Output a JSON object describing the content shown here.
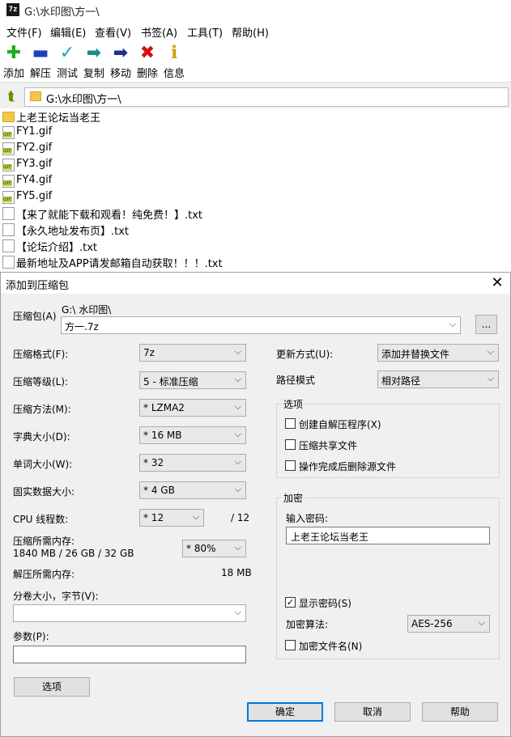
{
  "window": {
    "title": "G:\\水印图\\方一\\",
    "app_icon": "7z"
  },
  "menu": [
    "文件(F)",
    "编辑(E)",
    "查看(V)",
    "书签(A)",
    "工具(T)",
    "帮助(H)"
  ],
  "toolbar": [
    {
      "label": "添加",
      "icon": "plus-icon",
      "glyph": "✚",
      "color": "#22aa22"
    },
    {
      "label": "解压",
      "icon": "minus-icon",
      "glyph": "▬",
      "color": "#1f3fbf"
    },
    {
      "label": "测试",
      "icon": "check-icon",
      "glyph": "✓",
      "color": "#19a7b5"
    },
    {
      "label": "复制",
      "icon": "copy-arrow-icon",
      "glyph": "➡",
      "color": "#1a8a8a"
    },
    {
      "label": "移动",
      "icon": "move-arrow-icon",
      "glyph": "➡",
      "color": "#1c2f8f"
    },
    {
      "label": "删除",
      "icon": "delete-icon",
      "glyph": "✖",
      "color": "#d01010"
    },
    {
      "label": "信息",
      "icon": "info-icon",
      "glyph": "ℹ",
      "color": "#c9a400"
    }
  ],
  "address": {
    "path": "G:\\水印图\\方一\\"
  },
  "files": [
    {
      "name": "上老王论坛当老王",
      "type": "folder"
    },
    {
      "name": "FY1.gif",
      "type": "gif"
    },
    {
      "name": "FY2.gif",
      "type": "gif"
    },
    {
      "name": "FY3.gif",
      "type": "gif"
    },
    {
      "name": "FY4.gif",
      "type": "gif"
    },
    {
      "name": "FY5.gif",
      "type": "gif"
    },
    {
      "name": "【来了就能下载和观看！纯免费！】.txt",
      "type": "txt"
    },
    {
      "name": "【永久地址发布页】.txt",
      "type": "txt"
    },
    {
      "name": "【论坛介绍】.txt",
      "type": "txt"
    },
    {
      "name": "最新地址及APP请发邮箱自动获取！！！.txt",
      "type": "txt"
    }
  ],
  "dialog": {
    "title": "添加到压缩包",
    "archive_label": "压缩包(A)",
    "archive_dir": "G:\\ 水印图\\",
    "archive_name": "方一.7z",
    "browse_label": "...",
    "format_label": "压缩格式(F):",
    "format_value": "7z",
    "level_label": "压缩等级(L):",
    "level_value": "5 - 标准压缩",
    "method_label": "压缩方法(M):",
    "method_value": "*  LZMA2",
    "dict_label": "字典大小(D):",
    "dict_value": "*  16 MB",
    "word_label": "单词大小(W):",
    "word_value": "*  32",
    "solid_label": "固实数据大小:",
    "solid_value": "*  4 GB",
    "cpu_label": "CPU 线程数:",
    "cpu_value": "*  12",
    "cpu_total": "/  12",
    "mem_label": "压缩所需内存:",
    "mem_detail": "1840 MB / 26 GB / 32 GB",
    "mem_value": "*  80%",
    "decomp_label": "解压所需内存:",
    "decomp_value": "18 MB",
    "split_label": "分卷大小，字节(V):",
    "split_value": "",
    "params_label": "参数(P):",
    "params_value": "",
    "options_button": "选项",
    "update_label": "更新方式(U):",
    "update_value": "添加并替换文件",
    "path_label": "路径模式",
    "path_value": "相对路径",
    "options_group": "选项",
    "opt_sfx": "创建自解压程序(X)",
    "opt_shared": "压缩共享文件",
    "opt_delete": "操作完成后删除源文件",
    "encrypt_group": "加密",
    "password_label": "输入密码:",
    "password_value": "上老王论坛当老王",
    "show_password": "显示密码(S)",
    "show_password_checked": true,
    "enc_method_label": "加密算法:",
    "enc_method_value": "AES-256",
    "enc_names": "加密文件名(N)",
    "ok": "确定",
    "cancel": "取消",
    "help": "帮助"
  }
}
